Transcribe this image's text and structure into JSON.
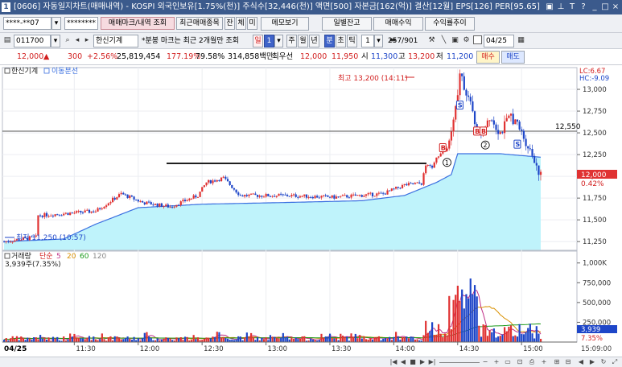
{
  "window": {
    "title": "[0606] 자동일지차트(매매내역) - KOSPI 외국인보유[1.75%(천)] 주식수[32,446(천)] 액면[500] 자본금[162(억)] 결산[12월] EPS[126] PER[95.65]",
    "icon_label": "1"
  },
  "toolbar1": {
    "account": "****-**07",
    "password": "********",
    "trade_mark_btn": "매매마크/내역 조회",
    "recent_btn": "최근매매종목",
    "tab_balance": "잔",
    "tab_execution": "체",
    "tab_unfilled": "미",
    "memo_btn": "메모보기",
    "daily_balance_btn": "일별잔고",
    "trade_profit_btn": "매매수익",
    "profit_trend_btn": "수익률추이"
  },
  "toolbar2": {
    "stock_code": "011700",
    "stock_name": "한신기계",
    "note": "*분봉 마크는 최근 2개월만 조회",
    "period_day": "일",
    "period_value": "1",
    "period_week": "주",
    "period_month": "월",
    "period_year": "년",
    "unit_min": "분",
    "unit_sec": "초",
    "unit_tick": "틱",
    "interval_value": "1",
    "count_display": "257/901",
    "date_value": "04/25"
  },
  "quote": {
    "price": "12,000",
    "change": "300",
    "change_pct": "+2.56%",
    "volume": "25,819,454",
    "vol_ratio": "177.19%",
    "turnover": "79.58%",
    "amount": "314,858백만",
    "best_ask_label": "최우선",
    "best_ask": "12,000",
    "best_bid": "11,950",
    "open_label": "시",
    "open": "11,300",
    "high_label": "고",
    "high": "13,200",
    "low_label": "저",
    "low": "11,200",
    "buy_btn": "매수",
    "sell_btn": "매도"
  },
  "price_panel": {
    "legend_stock": "한신기계",
    "legend_ma": "이동분선",
    "lc": "LC:6.67",
    "hc": "HC:-9.09",
    "high_annotation": "최고 13,200 (14:11)",
    "low_annotation": "최저 11,250 (10:57)",
    "hline_value": "12,550",
    "current_price_tag": "12,000",
    "current_pct_tag": "0.42%",
    "y_ticks": [
      "13,000",
      "12,750",
      "12,500",
      "12,250",
      "12,000",
      "11,750",
      "11,500",
      "11,250"
    ]
  },
  "volume_panel": {
    "legend_volume": "거래량",
    "legend_simple": "단순",
    "ma_periods": [
      "5",
      "20",
      "60",
      "120"
    ],
    "last_volume_text": "3,939주(7.35%)",
    "y_ticks": [
      "1,000K",
      "750,000",
      "500,000",
      "250,000"
    ],
    "current_tag": "3,939",
    "current_pct": "7.35%"
  },
  "time_axis": {
    "date": "04/25",
    "labels": [
      "11:30",
      "12:00",
      "12:30",
      "13:00",
      "13:30",
      "14:00",
      "14:30",
      "15:00"
    ],
    "right_label": "15:09:00"
  },
  "chart_data": {
    "type": "candlestick",
    "title": "한신기계",
    "interval": "1분",
    "x_range": [
      "10:57",
      "15:09"
    ],
    "ylim": [
      11150,
      13250
    ],
    "open": 11300,
    "high": 13200,
    "high_time": "14:11",
    "low": 11250,
    "low_time": "10:57",
    "close": 12000,
    "ma_series": [
      {
        "name": "이동분선",
        "color": "#3a6fe0"
      }
    ],
    "volume_ylim": [
      0,
      1150000
    ],
    "volume_ma_periods": [
      5,
      20,
      60,
      120
    ]
  },
  "colors": {
    "up": "#e03232",
    "down": "#1e46c8",
    "ma_line": "#3a6fe0",
    "ma_fill": "#bff3fb",
    "titlebar": "#3b5a8c"
  }
}
